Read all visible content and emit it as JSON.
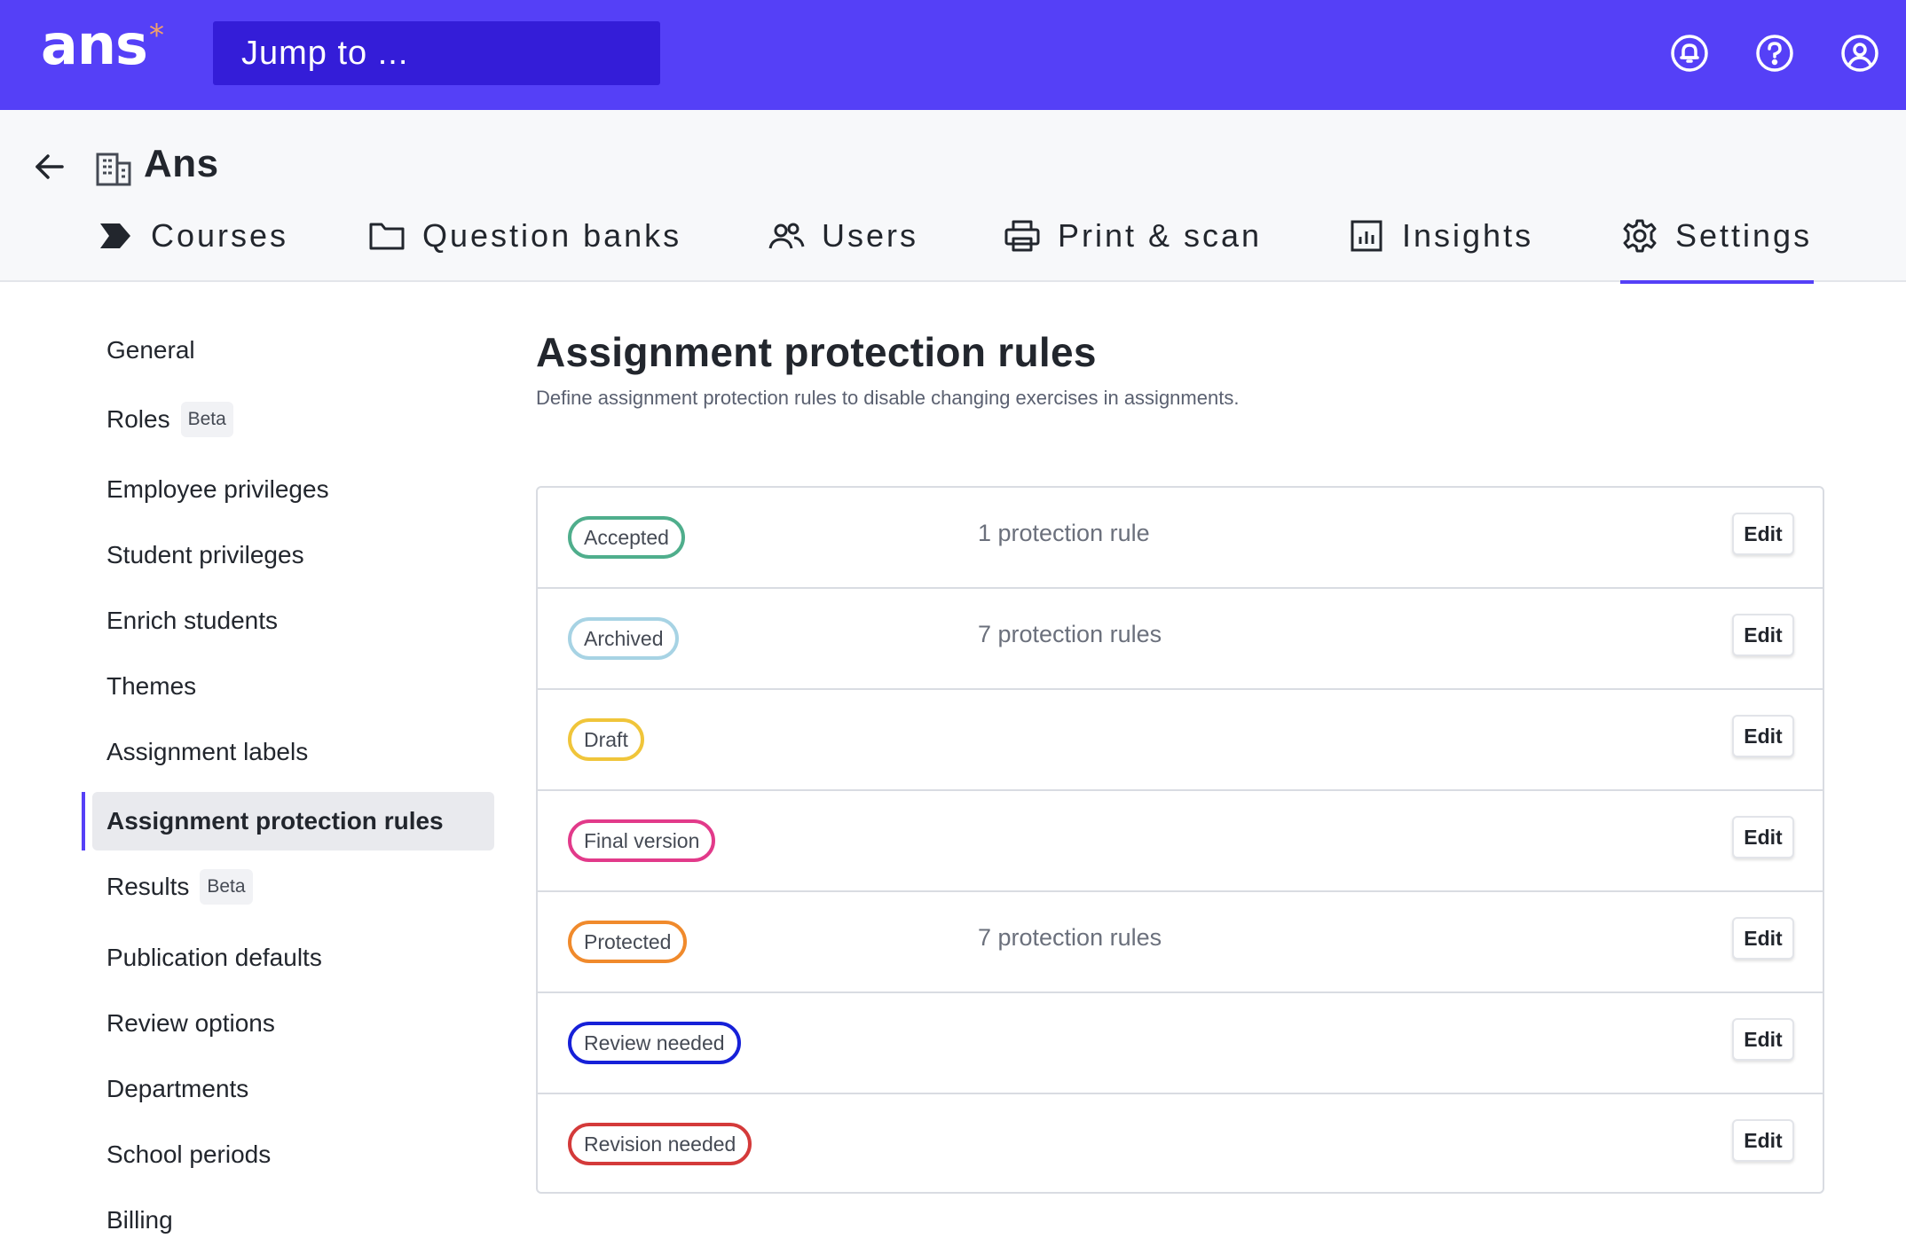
{
  "topbar": {
    "logo": "ans",
    "logo_star": "*",
    "jump_placeholder": "Jump to ..."
  },
  "header": {
    "org_name": "Ans",
    "tabs": [
      {
        "label": "Courses",
        "icon": "courses-chevron-icon"
      },
      {
        "label": "Question banks",
        "icon": "folder-icon"
      },
      {
        "label": "Users",
        "icon": "users-icon"
      },
      {
        "label": "Print & scan",
        "icon": "printer-icon"
      },
      {
        "label": "Insights",
        "icon": "chart-icon"
      },
      {
        "label": "Settings",
        "icon": "gear-icon",
        "active": true
      }
    ]
  },
  "sidenav": {
    "items": [
      {
        "label": "General"
      },
      {
        "label": "Roles",
        "badge": "Beta"
      },
      {
        "label": "Employee privileges"
      },
      {
        "label": "Student privileges"
      },
      {
        "label": "Enrich students"
      },
      {
        "label": "Themes"
      },
      {
        "label": "Assignment labels"
      },
      {
        "label": "Assignment protection rules",
        "active": true
      },
      {
        "label": "Results",
        "badge": "Beta"
      },
      {
        "label": "Publication defaults"
      },
      {
        "label": "Review options"
      },
      {
        "label": "Departments"
      },
      {
        "label": "School periods"
      },
      {
        "label": "Billing"
      }
    ]
  },
  "main": {
    "title": "Assignment protection rules",
    "description": "Define assignment protection rules to disable changing exercises in assignments.",
    "edit_label": "Edit",
    "rules": [
      {
        "label": "Accepted",
        "count": "1 protection rule",
        "color": "#4fae8c"
      },
      {
        "label": "Archived",
        "count": "7 protection rules",
        "color": "#a7d3e4"
      },
      {
        "label": "Draft",
        "count": "",
        "color": "#f0c53a"
      },
      {
        "label": "Final version",
        "count": "",
        "color": "#e23a8a"
      },
      {
        "label": "Protected",
        "count": "7 protection rules",
        "color": "#f08a2c"
      },
      {
        "label": "Review needed",
        "count": "",
        "color": "#1620d8"
      },
      {
        "label": "Revision needed",
        "count": "",
        "color": "#d43a3a"
      }
    ]
  },
  "colors": {
    "brand": "#5540f7",
    "brand_dark": "#341dd8",
    "accent_star": "#f2a06a"
  }
}
